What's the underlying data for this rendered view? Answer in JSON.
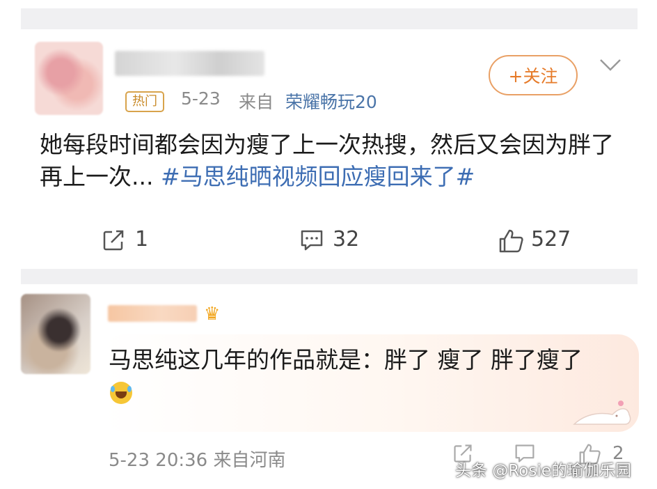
{
  "post": {
    "badge": "热门",
    "date": "5-23",
    "from_label": "来自",
    "device": "荣耀畅玩20",
    "follow_label": "+关注",
    "text_plain": "她每段时间都会因为瘦了上一次热搜，然后又会因为胖了再上一次...",
    "text_hashtag": "#马思纯晒视频回应瘦回来了#",
    "actions": {
      "share_count": "1",
      "comment_count": "32",
      "like_count": "527"
    }
  },
  "reply": {
    "text": "马思纯这几年的作品就是：胖了 瘦了 胖了瘦了",
    "timestamp": "5-23 20:36",
    "from_label": "来自河南",
    "like_count": "2"
  },
  "watermark": "头条 @Rosie的瑜伽乐园",
  "icons": {
    "share": "share-icon",
    "comment": "comment-icon",
    "like": "thumbs-up-icon",
    "chevron": "chevron-down-icon",
    "crown": "crown-icon",
    "emoji": "laugh-icon"
  },
  "colors": {
    "accent_orange": "#e67b2a",
    "hashtag_blue": "#3d6db3",
    "meta_gray": "#8a8a8a"
  }
}
